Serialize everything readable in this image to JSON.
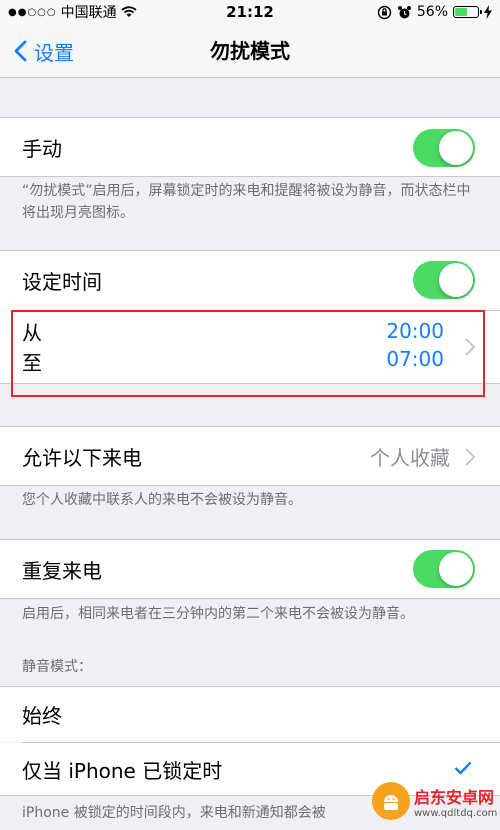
{
  "status_bar": {
    "signal": "●●○○○",
    "carrier": "中国联通",
    "time": "21:12",
    "battery": "56%",
    "battery_level": 0.56
  },
  "nav": {
    "back_label": "设置",
    "title": "勿扰模式"
  },
  "manual": {
    "label": "手动",
    "enabled": true,
    "footer": "“勿扰模式”启用后，屏幕锁定时的来电和提醒将被设为静音，而状态栏中将出现月亮图标。"
  },
  "scheduled": {
    "label": "设定时间",
    "enabled": true,
    "from_label": "从",
    "from_time": "20:00",
    "to_label": "至",
    "to_time": "07:00"
  },
  "allow_calls": {
    "label": "允许以下来电",
    "value": "个人收藏",
    "footer": "您个人收藏中联系人的来电不会被设为静音。"
  },
  "repeated_calls": {
    "label": "重复来电",
    "enabled": true,
    "footer": "启用后，相同来电者在三分钟内的第二个来电不会被设为静音。"
  },
  "silence": {
    "header": "静音模式：",
    "always": "始终",
    "locked_only": "仅当 iPhone 已锁定时",
    "footer": "iPhone 被锁定的时间段内，来电和新通知都会被"
  },
  "watermark": {
    "title": "启东安卓网",
    "url": "www.qdltdq.com"
  },
  "colors": {
    "accent": "#157efb",
    "toggle_on": "#4cd964",
    "highlight": "#e2262c",
    "background": "#efeff4"
  }
}
